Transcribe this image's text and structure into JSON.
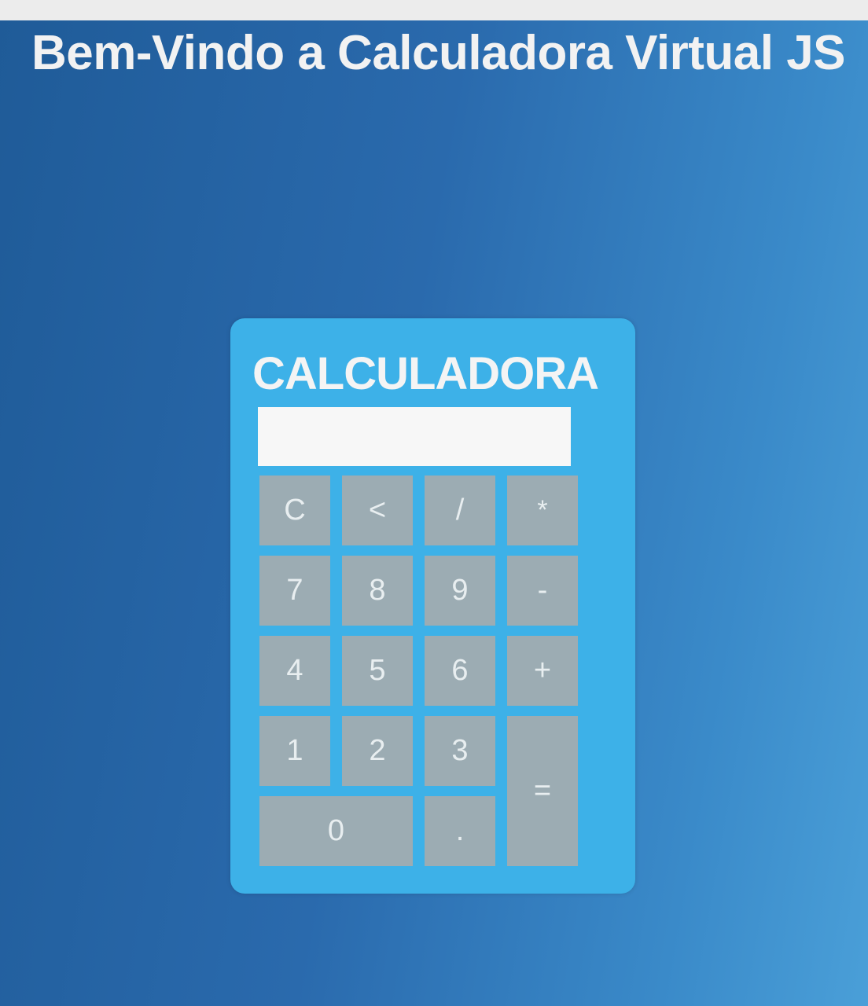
{
  "page": {
    "title": "Bem-Vindo a Calculadora Virtual JS"
  },
  "calculator": {
    "title": "CALCULADORA",
    "display_value": "",
    "keys": {
      "clear": "C",
      "backspace": "<",
      "divide": "/",
      "multiply": "*",
      "seven": "7",
      "eight": "8",
      "nine": "9",
      "subtract": "-",
      "four": "4",
      "five": "5",
      "six": "6",
      "add": "+",
      "one": "1",
      "two": "2",
      "three": "3",
      "equals": "=",
      "zero": "0",
      "decimal": "."
    }
  },
  "colors": {
    "background": "#2a6aad",
    "calculator_body": "#3db1e8",
    "key": "#9cacb3",
    "display": "#f7f7f7"
  }
}
